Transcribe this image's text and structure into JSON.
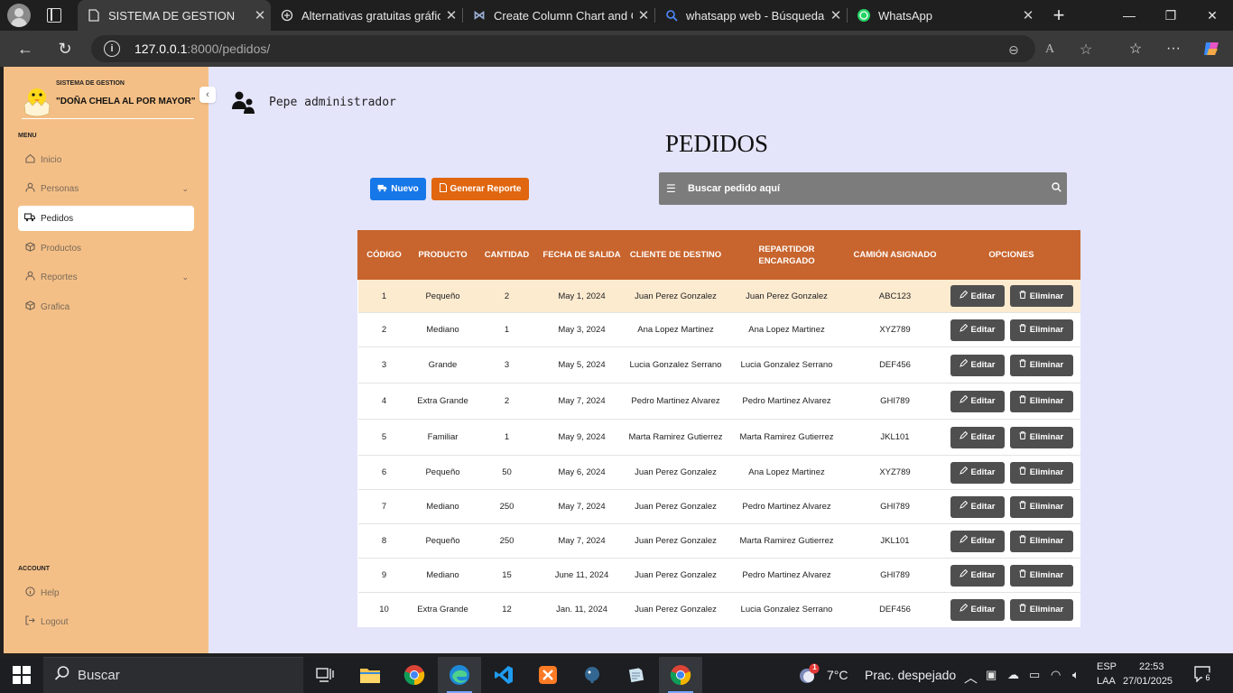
{
  "browser": {
    "tabs": [
      {
        "label": "SISTEMA DE GESTION",
        "icon": "page-icon",
        "active": true
      },
      {
        "label": "Alternativas gratuitas gráfica",
        "icon": "chatgpt-icon"
      },
      {
        "label": "Create Column Chart and Gr",
        "icon": "code-icon"
      },
      {
        "label": "whatsapp web - Búsqueda",
        "icon": "search-icon"
      },
      {
        "label": "WhatsApp",
        "icon": "whatsapp-icon"
      }
    ],
    "url_host": "127.0.0.1",
    "url_path": ":8000/pedidos/"
  },
  "sidebar": {
    "brand_small": "SISTEMA DE GESTION",
    "brand_big": "\"DOÑA CHELA AL POR MAYOR\"",
    "menu_label": "MENU",
    "items": [
      {
        "label": "Inicio",
        "icon": "home-icon"
      },
      {
        "label": "Personas",
        "icon": "user-icon"
      },
      {
        "label": "Pedidos",
        "icon": "truck-icon"
      },
      {
        "label": "Productos",
        "icon": "box-icon"
      },
      {
        "label": "Reportes",
        "icon": "user-icon"
      },
      {
        "label": "Grafica",
        "icon": "box-icon"
      }
    ],
    "account_label": "ACCOUNT",
    "account_items": [
      {
        "label": "Help",
        "icon": "info-icon"
      },
      {
        "label": "Logout",
        "icon": "logout-icon"
      }
    ]
  },
  "header": {
    "user_name": "Pepe administrador"
  },
  "main": {
    "title": "PEDIDOS",
    "new_button": "Nuevo",
    "report_button": "Generar Reporte",
    "search_placeholder": "Buscar pedido aquí",
    "columns": [
      "CÓDIGO",
      "PRODUCTO",
      "CANTIDAD",
      "FECHA DE SALIDA",
      "CLIENTE DE DESTINO",
      "REPARTIDOR ENCARGADO",
      "CAMIÓN ASIGNADO",
      "OPCIONES"
    ],
    "edit_label": "Editar",
    "delete_label": "Eliminar",
    "rows": [
      {
        "codigo": "1",
        "producto": "Pequeño",
        "cantidad": "2",
        "fecha": "May 1, 2024",
        "cliente": "Juan Perez Gonzalez",
        "repartidor": "Juan Perez Gonzalez",
        "camion": "ABC123"
      },
      {
        "codigo": "2",
        "producto": "Mediano",
        "cantidad": "1",
        "fecha": "May 3, 2024",
        "cliente": "Ana Lopez Martinez",
        "repartidor": "Ana Lopez Martinez",
        "camion": "XYZ789"
      },
      {
        "codigo": "3",
        "producto": "Grande",
        "cantidad": "3",
        "fecha": "May 5, 2024",
        "cliente": "Lucia Gonzalez Serrano",
        "repartidor": "Lucia Gonzalez Serrano",
        "camion": "DEF456"
      },
      {
        "codigo": "4",
        "producto": "Extra Grande",
        "cantidad": "2",
        "fecha": "May 7, 2024",
        "cliente": "Pedro Martinez Alvarez",
        "repartidor": "Pedro Martinez Alvarez",
        "camion": "GHI789"
      },
      {
        "codigo": "5",
        "producto": "Familiar",
        "cantidad": "1",
        "fecha": "May 9, 2024",
        "cliente": "Marta Ramirez Gutierrez",
        "repartidor": "Marta Ramirez Gutierrez",
        "camion": "JKL101"
      },
      {
        "codigo": "6",
        "producto": "Pequeño",
        "cantidad": "50",
        "fecha": "May 6, 2024",
        "cliente": "Juan Perez Gonzalez",
        "repartidor": "Ana Lopez Martinez",
        "camion": "XYZ789"
      },
      {
        "codigo": "7",
        "producto": "Mediano",
        "cantidad": "250",
        "fecha": "May 7, 2024",
        "cliente": "Juan Perez Gonzalez",
        "repartidor": "Pedro Martinez Alvarez",
        "camion": "GHI789"
      },
      {
        "codigo": "8",
        "producto": "Pequeño",
        "cantidad": "250",
        "fecha": "May 7, 2024",
        "cliente": "Juan Perez Gonzalez",
        "repartidor": "Marta Ramirez Gutierrez",
        "camion": "JKL101"
      },
      {
        "codigo": "9",
        "producto": "Mediano",
        "cantidad": "15",
        "fecha": "June 11, 2024",
        "cliente": "Juan Perez Gonzalez",
        "repartidor": "Pedro Martinez Alvarez",
        "camion": "GHI789"
      },
      {
        "codigo": "10",
        "producto": "Extra Grande",
        "cantidad": "12",
        "fecha": "Jan. 11, 2024",
        "cliente": "Juan Perez Gonzalez",
        "repartidor": "Lucia Gonzalez Serrano",
        "camion": "DEF456"
      }
    ]
  },
  "taskbar": {
    "search_label": "Buscar",
    "weather_temp": "7°C",
    "weather_text": "Prac. despejado",
    "weather_badge": "1",
    "lang_top": "ESP",
    "lang_bottom": "LAA",
    "time": "22:53",
    "date": "27/01/2025",
    "notif_count": "6"
  },
  "colors": {
    "sidebar_bg": "#f4bf86",
    "page_bg": "#e4e5fb",
    "table_header": "#c8642d",
    "new_button": "#1677e8",
    "report_button": "#e0660f",
    "search_bg": "#7c7c7c",
    "option_button": "#4f4f4f",
    "highlight_row": "#fdebd0"
  }
}
